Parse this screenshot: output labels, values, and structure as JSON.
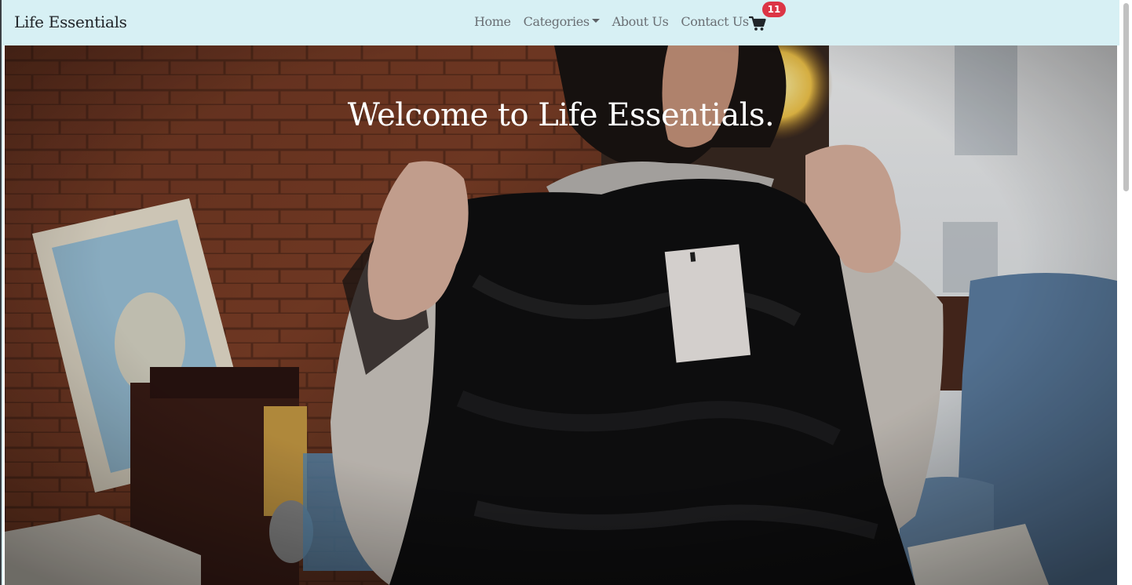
{
  "navbar": {
    "brand": "Life Essentials",
    "links": [
      {
        "label": "Home"
      },
      {
        "label": "Categories",
        "dropdown": true
      },
      {
        "label": "About Us"
      },
      {
        "label": "Contact Us"
      }
    ],
    "cart": {
      "icon": "shopping-cart-icon",
      "count": "11"
    },
    "background": "#d7f0f4"
  },
  "hero": {
    "title": "Welcome to Life Essentials.",
    "image": "woman holding black lace dress with price tag"
  },
  "colors": {
    "badge": "#dc3545",
    "nav_text": "#6a6f74"
  }
}
